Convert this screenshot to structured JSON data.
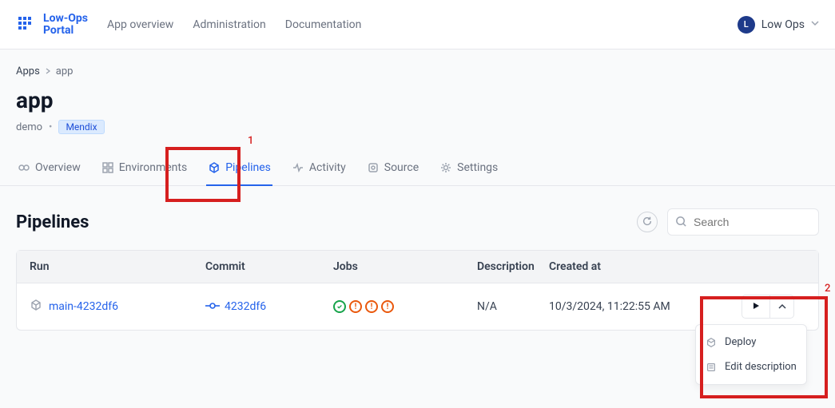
{
  "brand": {
    "line1": "Low-Ops",
    "line2": "Portal"
  },
  "nav": {
    "overview": "App overview",
    "admin": "Administration",
    "docs": "Documentation"
  },
  "user": {
    "initial": "L",
    "name": "Low Ops"
  },
  "breadcrumb": {
    "root": "Apps",
    "current": "app"
  },
  "page": {
    "title": "app",
    "namespace": "demo",
    "tag": "Mendix"
  },
  "tabs": {
    "overview": "Overview",
    "environments": "Environments",
    "pipelines": "Pipelines",
    "activity": "Activity",
    "source": "Source",
    "settings": "Settings"
  },
  "section": {
    "title": "Pipelines",
    "search_placeholder": "Search"
  },
  "table": {
    "headers": {
      "run": "Run",
      "commit": "Commit",
      "jobs": "Jobs",
      "description": "Description",
      "created": "Created at"
    },
    "rows": [
      {
        "run": "main-4232df6",
        "commit": "4232df6",
        "description": "N/A",
        "created": "10/3/2024, 11:22:55 AM"
      }
    ]
  },
  "dropdown": {
    "deploy": "Deploy",
    "edit": "Edit description"
  },
  "annot": {
    "one": "1",
    "two": "2"
  }
}
